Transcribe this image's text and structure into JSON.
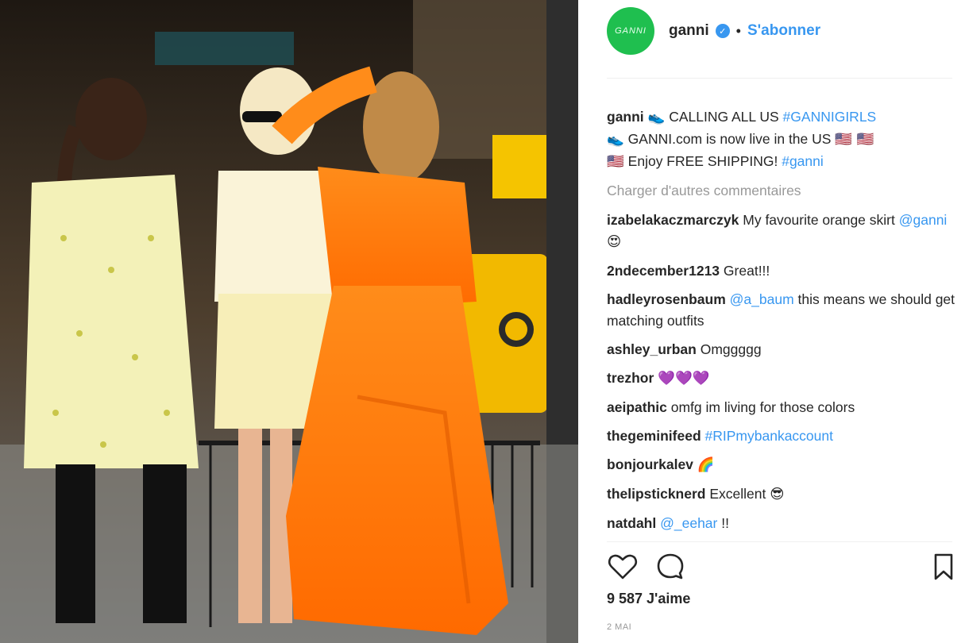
{
  "post": {
    "author": "ganni",
    "avatar_text": "GANNI",
    "follow_label": "S'abonner",
    "caption": {
      "user": "ganni",
      "line1": "CALLING ALL US",
      "line1_tag": "#GANNIGIRLS",
      "line2": "GANNI.com is now live in the US",
      "line3": "Enjoy FREE SHIPPING!",
      "line3_tag": "#ganni"
    },
    "load_more": "Charger d'autres commentaires",
    "likes": "9 587 J'aime",
    "date": "2 MAI"
  },
  "comments": [
    {
      "user": "izabelakaczmarczyk",
      "text": "My favourite orange skirt",
      "mention": "@ganni",
      "emoji": "😍"
    },
    {
      "user": "2ndecember1213",
      "text": "Great!!!"
    },
    {
      "user": "hadleyrosenbaum",
      "mention": "@a_baum",
      "text": "this means we should get matching outfits"
    },
    {
      "user": "ashley_urban",
      "text": "Omggggg"
    },
    {
      "user": "trezhor",
      "emoji": "💜💜💜"
    },
    {
      "user": "aeipathic",
      "text": "omfg im living for those colors"
    },
    {
      "user": "thegeminifeed",
      "tag": "#RIPmybankaccount"
    },
    {
      "user": "bonjourkalev",
      "emoji": "🌈"
    },
    {
      "user": "thelipsticknerd",
      "text": "Excellent",
      "emoji": "😎"
    },
    {
      "user": "natdahl",
      "mention": "@_eehar",
      "text": "!!"
    }
  ],
  "icons": {
    "like": "heart-icon",
    "comment": "comment-bubble-icon",
    "save": "bookmark-icon",
    "verified": "verified-badge-icon"
  },
  "colors": {
    "accent": "#3897f0",
    "avatar_bg": "#1fbf4f",
    "muted": "#999999"
  }
}
